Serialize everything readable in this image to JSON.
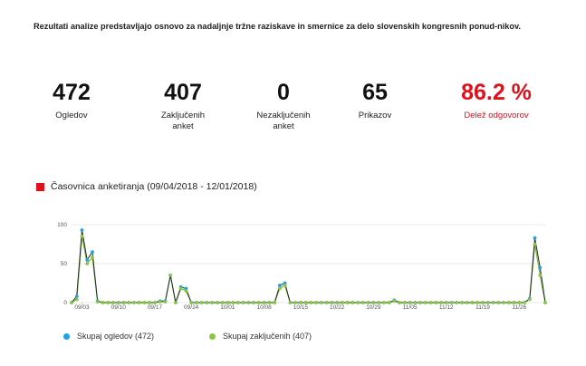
{
  "intro": {
    "text": "Rezultati analize predstavljajo osnovo za nadaljnje tržne raziskave in smernice za delo slovenskih kongresnih ponud-nikov."
  },
  "stats": [
    {
      "value": "472",
      "label": "Ogledov"
    },
    {
      "value": "407",
      "label": "Zaključenih anket"
    },
    {
      "value": "0",
      "label": "Nezaključenih anket"
    },
    {
      "value": "65",
      "label": "Prikazov"
    },
    {
      "value": "86.2 %",
      "label": "Delež odgovorov"
    }
  ],
  "timeline": {
    "title": "Časovnica anketiranja (09/04/2018 - 12/01/2018)",
    "accent_color": "#e1101b"
  },
  "chart_data": {
    "type": "line",
    "x_tick_labels": [
      "09/03",
      "09/10",
      "09/17",
      "09/24",
      "10/01",
      "10/08",
      "10/15",
      "10/22",
      "10/29",
      "11/05",
      "11/12",
      "11/19",
      "11/26"
    ],
    "ylim": [
      0,
      100
    ],
    "y_ticks": [
      0,
      50,
      100
    ],
    "grid": true,
    "legend_position": "bottom",
    "series": [
      {
        "name": "Skupaj ogledov (472)",
        "color": "#1aa3e8",
        "values": [
          0,
          8,
          93,
          55,
          65,
          2,
          0,
          0,
          0,
          0,
          0,
          0,
          0,
          0,
          0,
          0,
          0,
          2,
          2,
          35,
          0,
          20,
          18,
          0,
          0,
          0,
          0,
          0,
          0,
          0,
          0,
          0,
          0,
          0,
          0,
          0,
          0,
          0,
          0,
          0,
          22,
          25,
          0,
          0,
          0,
          0,
          0,
          0,
          0,
          0,
          0,
          0,
          0,
          0,
          0,
          0,
          0,
          0,
          0,
          0,
          0,
          0,
          3,
          0,
          0,
          0,
          0,
          0,
          0,
          0,
          0,
          0,
          0,
          0,
          0,
          0,
          0,
          0,
          0,
          0,
          0,
          0,
          0,
          0,
          0,
          0,
          0,
          0,
          5,
          83,
          45,
          0
        ]
      },
      {
        "name": "Skupaj zaključenih (407)",
        "color": "#8cc63e",
        "values": [
          0,
          4,
          85,
          50,
          58,
          1,
          0,
          0,
          0,
          0,
          0,
          0,
          0,
          0,
          0,
          0,
          0,
          1,
          1,
          35,
          0,
          18,
          15,
          0,
          0,
          0,
          0,
          0,
          0,
          0,
          0,
          0,
          0,
          0,
          0,
          0,
          0,
          0,
          0,
          0,
          18,
          22,
          0,
          0,
          0,
          0,
          0,
          0,
          0,
          0,
          0,
          0,
          0,
          0,
          0,
          0,
          0,
          0,
          0,
          0,
          0,
          0,
          2,
          0,
          0,
          0,
          0,
          0,
          0,
          0,
          0,
          0,
          0,
          0,
          0,
          0,
          0,
          0,
          0,
          0,
          0,
          0,
          0,
          0,
          0,
          0,
          0,
          0,
          4,
          75,
          35,
          0
        ]
      }
    ]
  }
}
